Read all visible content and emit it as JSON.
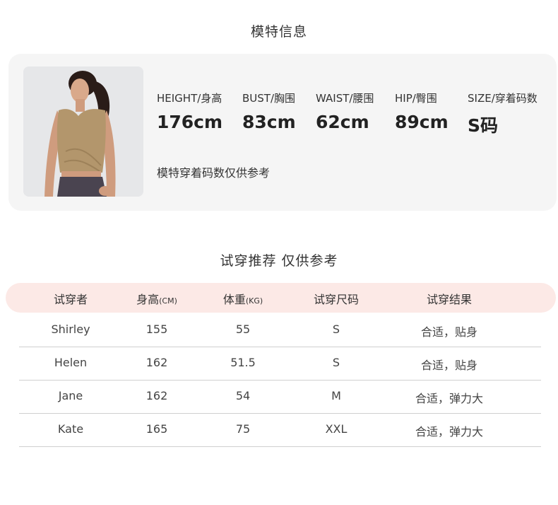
{
  "model_section": {
    "title": "模特信息",
    "stats": [
      {
        "label": "HEIGHT/身高",
        "value": "176cm"
      },
      {
        "label": "BUST/胸围",
        "value": "83cm"
      },
      {
        "label": "WAIST/腰围",
        "value": "62cm"
      },
      {
        "label": "HIP/臀围",
        "value": "89cm"
      },
      {
        "label": "SIZE/穿着码数",
        "value": "S码"
      }
    ],
    "note": "模特穿着码数仅供参考"
  },
  "trial_section": {
    "title": "试穿推荐 仅供参考",
    "headers": [
      {
        "main": "试穿者",
        "unit": ""
      },
      {
        "main": "身高",
        "unit": "(CM)"
      },
      {
        "main": "体重",
        "unit": "(KG)"
      },
      {
        "main": "试穿尺码",
        "unit": ""
      },
      {
        "main": "试穿结果",
        "unit": ""
      }
    ],
    "rows": [
      [
        "Shirley",
        "155",
        "55",
        "S",
        "合适，贴身"
      ],
      [
        "Helen",
        "162",
        "51.5",
        "S",
        "合适，贴身"
      ],
      [
        "Jane",
        "162",
        "54",
        "M",
        "合适，弹力大"
      ],
      [
        "Kate",
        "165",
        "75",
        "XXL",
        "合适，弹力大"
      ]
    ]
  },
  "colors": {
    "card_bg": "#f5f5f5",
    "header_bg": "#fce9e6",
    "shirt": "#b3966c",
    "leggings": "#4a4450"
  }
}
